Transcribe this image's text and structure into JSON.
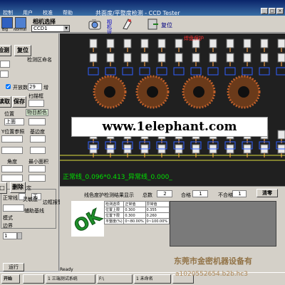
{
  "window": {
    "title": "共面度/平整度检测 - CCD Tester",
    "menu": [
      "控制",
      "用户",
      "校准",
      "帮助"
    ]
  },
  "toolbar": {
    "camera_select_label": "相机选择",
    "camera_value": "CCD1",
    "camera_settings_label": "相机设置",
    "reset_label": "复位",
    "icon_labels": [
      "Big",
      "Normal"
    ]
  },
  "left_panel": {
    "buttons": [
      "检测",
      "复位",
      "读取",
      "保存",
      "删除",
      "运行"
    ],
    "detect_area_label": "检测区命名",
    "enable_label": "开放",
    "count_value": "29",
    "count_suffix": "增",
    "scan_label": "扫描框",
    "position_label": "位置",
    "direction_value": "上面",
    "pass_color_label": "物目颜色",
    "y_position_label": "Y位置参照",
    "threshold_label": "基边度",
    "angle_label": "角度",
    "min_area_label": "最小面积",
    "box_setting_label": "形状设定",
    "normal_label": "正常线",
    "none_label": "无",
    "mode_label": "模式",
    "alarm_label": "边框报警",
    "sensitivity_label": "灵敏度",
    "aux_label": "辅助基线",
    "edge_label": "边界",
    "number_value": "1",
    "start_label": "运行"
  },
  "camera_view": {
    "protect_label": "焊盘保护",
    "overlay_text": "正常线_0.096*0.413_异常线_0.000_"
  },
  "watermark": "www.1elephant.com",
  "results": {
    "section_label": "线色度护检测结果显示",
    "total_label": "总数",
    "total_value": "2",
    "pass_label": "合格",
    "pass_value": "1",
    "fail_label": "不合格",
    "fail_value": "1",
    "clear_button": "清零",
    "ok_text": "OK",
    "table": [
      [
        "检测选项",
        "正常值",
        "异常值"
      ],
      [
        "位置上限",
        "0.300",
        "0.355"
      ],
      [
        "位置下限",
        "0.300",
        "0.260"
      ],
      [
        "平整度(%)",
        "0~80.00%",
        "0~100.00%"
      ]
    ]
  },
  "status": {
    "ready": "Ready",
    "company": "东莞市金密机器设备有",
    "site": "a1020552654.b2b.hc3"
  },
  "taskbar": {
    "items": [
      "开始",
      "",
      "1 三端测试系统",
      "F:\\",
      "1 未命名",
      "",
      ""
    ]
  },
  "colors": {
    "title_blue": "#0a246a",
    "overlay_green": "#00e000",
    "ok_green": "#1f8f2a"
  }
}
